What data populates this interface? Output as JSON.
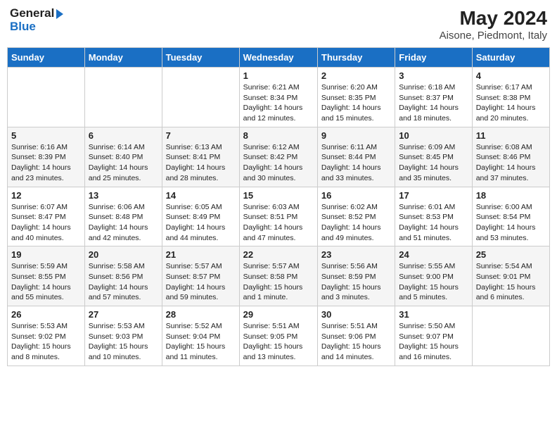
{
  "header": {
    "logo_line1": "General",
    "logo_line2": "Blue",
    "month_year": "May 2024",
    "location": "Aisone, Piedmont, Italy"
  },
  "weekdays": [
    "Sunday",
    "Monday",
    "Tuesday",
    "Wednesday",
    "Thursday",
    "Friday",
    "Saturday"
  ],
  "weeks": [
    [
      {
        "day": "",
        "sunrise": "",
        "sunset": "",
        "daylight": ""
      },
      {
        "day": "",
        "sunrise": "",
        "sunset": "",
        "daylight": ""
      },
      {
        "day": "",
        "sunrise": "",
        "sunset": "",
        "daylight": ""
      },
      {
        "day": "1",
        "sunrise": "Sunrise: 6:21 AM",
        "sunset": "Sunset: 8:34 PM",
        "daylight": "Daylight: 14 hours and 12 minutes."
      },
      {
        "day": "2",
        "sunrise": "Sunrise: 6:20 AM",
        "sunset": "Sunset: 8:35 PM",
        "daylight": "Daylight: 14 hours and 15 minutes."
      },
      {
        "day": "3",
        "sunrise": "Sunrise: 6:18 AM",
        "sunset": "Sunset: 8:37 PM",
        "daylight": "Daylight: 14 hours and 18 minutes."
      },
      {
        "day": "4",
        "sunrise": "Sunrise: 6:17 AM",
        "sunset": "Sunset: 8:38 PM",
        "daylight": "Daylight: 14 hours and 20 minutes."
      }
    ],
    [
      {
        "day": "5",
        "sunrise": "Sunrise: 6:16 AM",
        "sunset": "Sunset: 8:39 PM",
        "daylight": "Daylight: 14 hours and 23 minutes."
      },
      {
        "day": "6",
        "sunrise": "Sunrise: 6:14 AM",
        "sunset": "Sunset: 8:40 PM",
        "daylight": "Daylight: 14 hours and 25 minutes."
      },
      {
        "day": "7",
        "sunrise": "Sunrise: 6:13 AM",
        "sunset": "Sunset: 8:41 PM",
        "daylight": "Daylight: 14 hours and 28 minutes."
      },
      {
        "day": "8",
        "sunrise": "Sunrise: 6:12 AM",
        "sunset": "Sunset: 8:42 PM",
        "daylight": "Daylight: 14 hours and 30 minutes."
      },
      {
        "day": "9",
        "sunrise": "Sunrise: 6:11 AM",
        "sunset": "Sunset: 8:44 PM",
        "daylight": "Daylight: 14 hours and 33 minutes."
      },
      {
        "day": "10",
        "sunrise": "Sunrise: 6:09 AM",
        "sunset": "Sunset: 8:45 PM",
        "daylight": "Daylight: 14 hours and 35 minutes."
      },
      {
        "day": "11",
        "sunrise": "Sunrise: 6:08 AM",
        "sunset": "Sunset: 8:46 PM",
        "daylight": "Daylight: 14 hours and 37 minutes."
      }
    ],
    [
      {
        "day": "12",
        "sunrise": "Sunrise: 6:07 AM",
        "sunset": "Sunset: 8:47 PM",
        "daylight": "Daylight: 14 hours and 40 minutes."
      },
      {
        "day": "13",
        "sunrise": "Sunrise: 6:06 AM",
        "sunset": "Sunset: 8:48 PM",
        "daylight": "Daylight: 14 hours and 42 minutes."
      },
      {
        "day": "14",
        "sunrise": "Sunrise: 6:05 AM",
        "sunset": "Sunset: 8:49 PM",
        "daylight": "Daylight: 14 hours and 44 minutes."
      },
      {
        "day": "15",
        "sunrise": "Sunrise: 6:03 AM",
        "sunset": "Sunset: 8:51 PM",
        "daylight": "Daylight: 14 hours and 47 minutes."
      },
      {
        "day": "16",
        "sunrise": "Sunrise: 6:02 AM",
        "sunset": "Sunset: 8:52 PM",
        "daylight": "Daylight: 14 hours and 49 minutes."
      },
      {
        "day": "17",
        "sunrise": "Sunrise: 6:01 AM",
        "sunset": "Sunset: 8:53 PM",
        "daylight": "Daylight: 14 hours and 51 minutes."
      },
      {
        "day": "18",
        "sunrise": "Sunrise: 6:00 AM",
        "sunset": "Sunset: 8:54 PM",
        "daylight": "Daylight: 14 hours and 53 minutes."
      }
    ],
    [
      {
        "day": "19",
        "sunrise": "Sunrise: 5:59 AM",
        "sunset": "Sunset: 8:55 PM",
        "daylight": "Daylight: 14 hours and 55 minutes."
      },
      {
        "day": "20",
        "sunrise": "Sunrise: 5:58 AM",
        "sunset": "Sunset: 8:56 PM",
        "daylight": "Daylight: 14 hours and 57 minutes."
      },
      {
        "day": "21",
        "sunrise": "Sunrise: 5:57 AM",
        "sunset": "Sunset: 8:57 PM",
        "daylight": "Daylight: 14 hours and 59 minutes."
      },
      {
        "day": "22",
        "sunrise": "Sunrise: 5:57 AM",
        "sunset": "Sunset: 8:58 PM",
        "daylight": "Daylight: 15 hours and 1 minute."
      },
      {
        "day": "23",
        "sunrise": "Sunrise: 5:56 AM",
        "sunset": "Sunset: 8:59 PM",
        "daylight": "Daylight: 15 hours and 3 minutes."
      },
      {
        "day": "24",
        "sunrise": "Sunrise: 5:55 AM",
        "sunset": "Sunset: 9:00 PM",
        "daylight": "Daylight: 15 hours and 5 minutes."
      },
      {
        "day": "25",
        "sunrise": "Sunrise: 5:54 AM",
        "sunset": "Sunset: 9:01 PM",
        "daylight": "Daylight: 15 hours and 6 minutes."
      }
    ],
    [
      {
        "day": "26",
        "sunrise": "Sunrise: 5:53 AM",
        "sunset": "Sunset: 9:02 PM",
        "daylight": "Daylight: 15 hours and 8 minutes."
      },
      {
        "day": "27",
        "sunrise": "Sunrise: 5:53 AM",
        "sunset": "Sunset: 9:03 PM",
        "daylight": "Daylight: 15 hours and 10 minutes."
      },
      {
        "day": "28",
        "sunrise": "Sunrise: 5:52 AM",
        "sunset": "Sunset: 9:04 PM",
        "daylight": "Daylight: 15 hours and 11 minutes."
      },
      {
        "day": "29",
        "sunrise": "Sunrise: 5:51 AM",
        "sunset": "Sunset: 9:05 PM",
        "daylight": "Daylight: 15 hours and 13 minutes."
      },
      {
        "day": "30",
        "sunrise": "Sunrise: 5:51 AM",
        "sunset": "Sunset: 9:06 PM",
        "daylight": "Daylight: 15 hours and 14 minutes."
      },
      {
        "day": "31",
        "sunrise": "Sunrise: 5:50 AM",
        "sunset": "Sunset: 9:07 PM",
        "daylight": "Daylight: 15 hours and 16 minutes."
      },
      {
        "day": "",
        "sunrise": "",
        "sunset": "",
        "daylight": ""
      }
    ]
  ]
}
